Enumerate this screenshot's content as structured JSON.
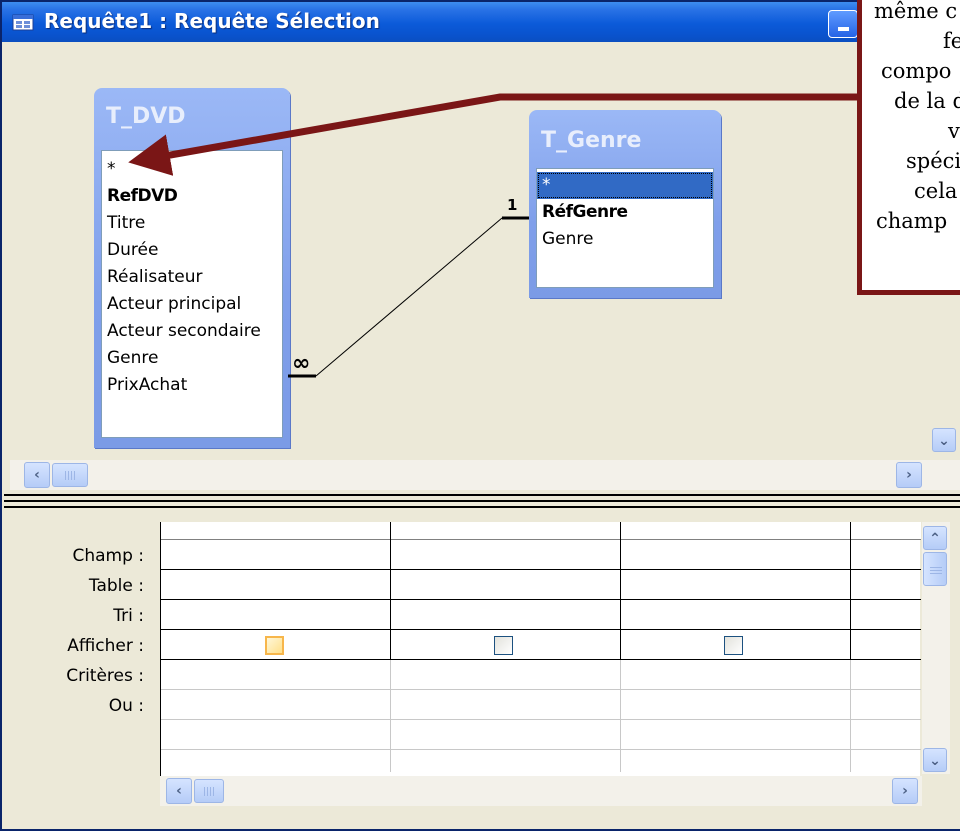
{
  "window": {
    "title": "Requête1 : Requête Sélection"
  },
  "tables": [
    {
      "name": "T_DVD",
      "fields": [
        {
          "label": "*",
          "key": false,
          "selected": false
        },
        {
          "label": "RefDVD",
          "key": true,
          "selected": false
        },
        {
          "label": "Titre",
          "key": false,
          "selected": false
        },
        {
          "label": "Durée",
          "key": false,
          "selected": false
        },
        {
          "label": "Réalisateur",
          "key": false,
          "selected": false
        },
        {
          "label": "Acteur principal",
          "key": false,
          "selected": false
        },
        {
          "label": "Acteur secondaire",
          "key": false,
          "selected": false
        },
        {
          "label": "Genre",
          "key": false,
          "selected": false
        },
        {
          "label": "PrixAchat",
          "key": false,
          "selected": false
        }
      ]
    },
    {
      "name": "T_Genre",
      "fields": [
        {
          "label": "*",
          "key": false,
          "selected": true
        },
        {
          "label": "RéfGenre",
          "key": true,
          "selected": false
        },
        {
          "label": "Genre",
          "key": false,
          "selected": false
        }
      ]
    }
  ],
  "relationship": {
    "one_side_label": "1",
    "many_side_label": "∞"
  },
  "design_grid": {
    "row_labels": [
      "Champ :",
      "Table :",
      "Tri :",
      "Afficher :",
      "Critères :",
      "Ou :"
    ],
    "show_checkboxes": [
      false,
      false,
      false
    ]
  },
  "callout": {
    "lines": [
      "même c",
      "fe",
      "compo",
      "de la d",
      "vo",
      "spécif",
      "cela i",
      "champ "
    ]
  },
  "icons": {
    "title": "query-icon",
    "minimize": "minimize-icon",
    "scroll_left": "arrow-left-icon",
    "scroll_right": "arrow-right-icon",
    "scroll_up": "arrow-up-icon",
    "scroll_down": "arrow-down-icon"
  },
  "colors": {
    "title_bar": "#0b5ad9",
    "callout_border": "#7a1616",
    "selection": "#316ac5"
  }
}
